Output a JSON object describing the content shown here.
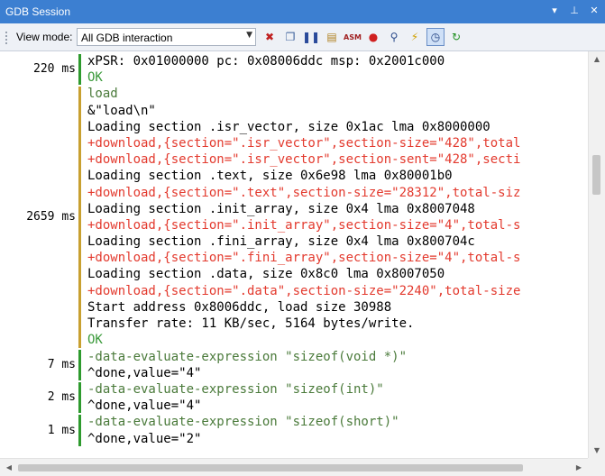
{
  "window": {
    "title": "GDB Session"
  },
  "title_controls": {
    "dropdown": "▾",
    "pin": "⊥",
    "close": "✕"
  },
  "toolbar": {
    "view_mode_label": "View mode:",
    "view_mode_value": "All GDB interaction",
    "dropdown_arrow": "▼",
    "icons": [
      {
        "name": "clear-icon",
        "glyph": "✖",
        "color": "#c02020"
      },
      {
        "name": "copy-icon",
        "glyph": "❐",
        "color": "#3a5f9a"
      },
      {
        "name": "pause-icon",
        "glyph": "❚❚",
        "color": "#2a4a9a"
      },
      {
        "name": "paste-icon",
        "glyph": "▤",
        "color": "#b08020"
      },
      {
        "name": "asm-icon",
        "glyph": "ASM",
        "color": "#a02020"
      },
      {
        "name": "stop-icon",
        "glyph": "●",
        "color": "#d02020"
      },
      {
        "name": "search-icon",
        "glyph": "⚲",
        "color": "#2a4a8a"
      },
      {
        "name": "lightning-icon",
        "glyph": "⚡",
        "color": "#d0a000"
      },
      {
        "name": "timer-icon",
        "glyph": "◷",
        "color": "#204080"
      },
      {
        "name": "refresh-icon",
        "glyph": "↻",
        "color": "#209020"
      }
    ]
  },
  "log": [
    {
      "timing": "220 ms",
      "bar_color": "#2e9a2e",
      "lines": [
        {
          "text": "xPSR: 0x01000000 pc: 0x08006ddc msp: 0x2001c000",
          "kind": "out"
        },
        {
          "text": "OK",
          "kind": "ok"
        }
      ]
    },
    {
      "timing": "2659 ms",
      "bar_color": "#c8a030",
      "lines": [
        {
          "text": "load",
          "kind": "cmd"
        },
        {
          "text": "&\"load\\n\"",
          "kind": "out"
        },
        {
          "text": "Loading section .isr_vector, size 0x1ac lma 0x8000000",
          "kind": "out"
        },
        {
          "text": "+download,{section=\".isr_vector\",section-size=\"428\",total",
          "kind": "async"
        },
        {
          "text": "+download,{section=\".isr_vector\",section-sent=\"428\",secti",
          "kind": "async"
        },
        {
          "text": "Loading section .text, size 0x6e98 lma 0x80001b0",
          "kind": "out"
        },
        {
          "text": "+download,{section=\".text\",section-size=\"28312\",total-siz",
          "kind": "async"
        },
        {
          "text": "Loading section .init_array, size 0x4 lma 0x8007048",
          "kind": "out"
        },
        {
          "text": "+download,{section=\".init_array\",section-size=\"4\",total-s",
          "kind": "async"
        },
        {
          "text": "Loading section .fini_array, size 0x4 lma 0x800704c",
          "kind": "out"
        },
        {
          "text": "+download,{section=\".fini_array\",section-size=\"4\",total-s",
          "kind": "async"
        },
        {
          "text": "Loading section .data, size 0x8c0 lma 0x8007050",
          "kind": "out"
        },
        {
          "text": "+download,{section=\".data\",section-size=\"2240\",total-size",
          "kind": "async"
        },
        {
          "text": "Start address 0x8006ddc, load size 30988",
          "kind": "out"
        },
        {
          "text": "Transfer rate: 11 KB/sec, 5164 bytes/write.",
          "kind": "out"
        },
        {
          "text": "OK",
          "kind": "ok"
        }
      ]
    },
    {
      "timing": "7 ms",
      "bar_color": "#2e9a2e",
      "lines": [
        {
          "text": "-data-evaluate-expression \"sizeof(void *)\"",
          "kind": "cmd"
        },
        {
          "text": "^done,value=\"4\"",
          "kind": "out"
        }
      ]
    },
    {
      "timing": "2 ms",
      "bar_color": "#2e9a2e",
      "lines": [
        {
          "text": "-data-evaluate-expression \"sizeof(int)\"",
          "kind": "cmd"
        },
        {
          "text": "^done,value=\"4\"",
          "kind": "out"
        }
      ]
    },
    {
      "timing": "1 ms",
      "bar_color": "#2e9a2e",
      "lines": [
        {
          "text": "-data-evaluate-expression \"sizeof(short)\"",
          "kind": "cmd"
        },
        {
          "text": "^done,value=\"2\"",
          "kind": "out"
        }
      ]
    }
  ],
  "scroll": {
    "up": "▲",
    "down": "▼",
    "left": "◀",
    "right": "▶"
  }
}
